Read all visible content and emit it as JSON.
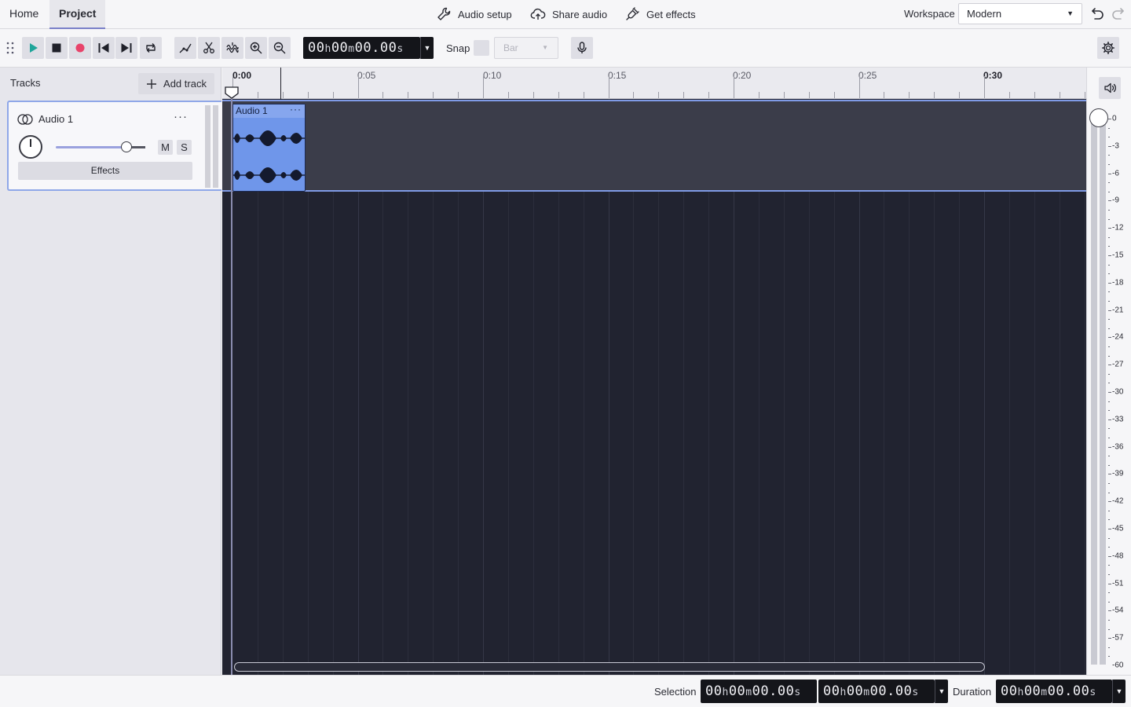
{
  "menubar": {
    "tabs": [
      {
        "label": "Home",
        "active": false
      },
      {
        "label": "Project",
        "active": true
      }
    ],
    "actions": {
      "audio_setup": "Audio setup",
      "share_audio": "Share audio",
      "get_effects": "Get effects"
    },
    "workspace": {
      "label": "Workspace",
      "value": "Modern"
    }
  },
  "toolbar": {
    "timecode": {
      "h": "00",
      "m": "00",
      "s": "00.00"
    },
    "snap": {
      "label": "Snap",
      "enabled": false,
      "value": "Bar"
    }
  },
  "tracks_panel": {
    "title": "Tracks",
    "add_track_label": "Add track",
    "tracks": [
      {
        "name": "Audio 1",
        "mute_label": "M",
        "solo_label": "S",
        "effects_label": "Effects",
        "volume": 0.78
      }
    ]
  },
  "timeline": {
    "ruler_labels": [
      "0:00",
      "0:05",
      "0:10",
      "0:15",
      "0:20",
      "0:25",
      "0:30"
    ],
    "clips": [
      {
        "name": "Audio 1",
        "menu": "···"
      }
    ]
  },
  "master_meter": {
    "db_labels": [
      "0",
      "-3",
      "-6",
      "-9",
      "-12",
      "-15",
      "-18",
      "-21",
      "-24",
      "-27",
      "-30",
      "-33",
      "-36",
      "-39",
      "-42",
      "-45",
      "-48",
      "-51",
      "-54",
      "-57",
      "-60"
    ]
  },
  "statusbar": {
    "selection_label": "Selection",
    "duration_label": "Duration",
    "selection_start": {
      "h": "00",
      "m": "00",
      "s": "00.00"
    },
    "selection_end": {
      "h": "00",
      "m": "00",
      "s": "00.00"
    },
    "duration": {
      "h": "00",
      "m": "00",
      "s": "00.00"
    }
  },
  "colors": {
    "accent": "#7f9be6",
    "clip": "#6f96ea",
    "canvas": "#212330",
    "play": "#1fa59a",
    "record": "#e8436a"
  }
}
